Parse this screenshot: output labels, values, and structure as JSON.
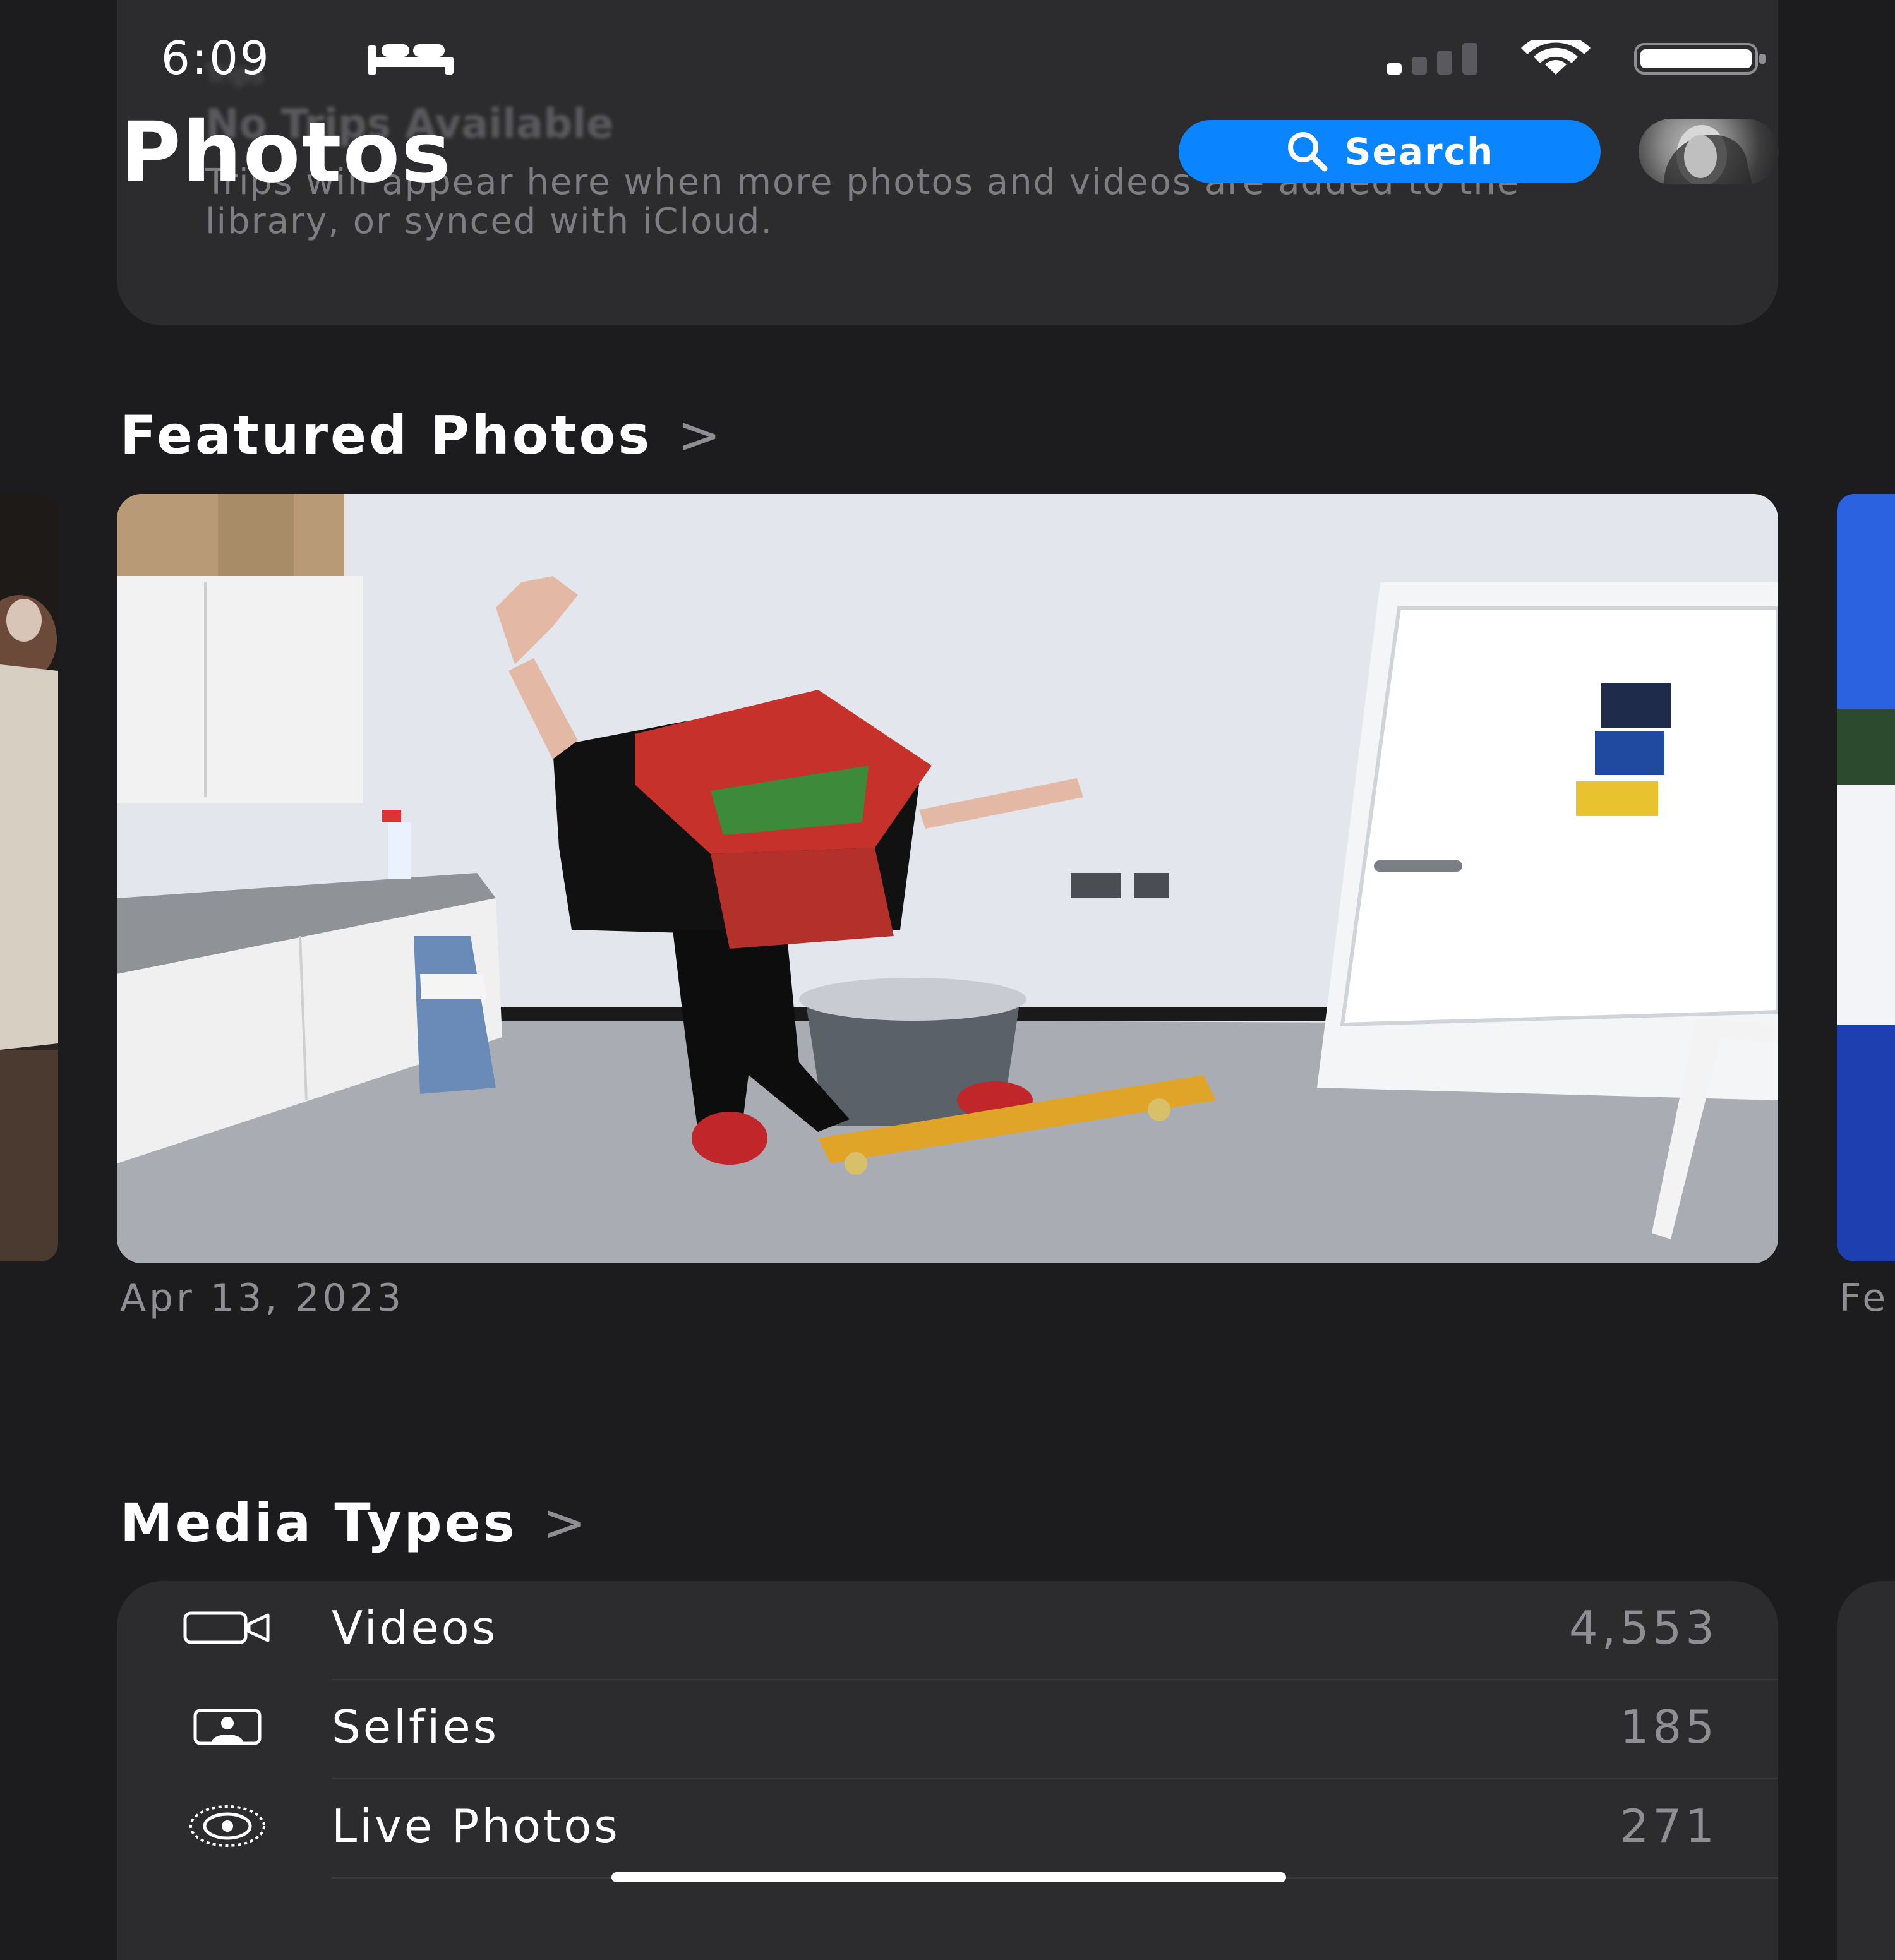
{
  "status_bar": {
    "time": "6:09",
    "sleep_icon": "bed-icon",
    "signal_icon": "cellular-signal-icon",
    "wifi_icon": "wifi-icon",
    "battery_icon": "battery-icon"
  },
  "header": {
    "title": "Photos",
    "search_label": "Search",
    "search_icon": "magnifying-glass-icon"
  },
  "trips_card": {
    "small_label": "Trips",
    "title": "No Trips Available",
    "body": "Trips will appear here when more photos and videos are added to the library, or synced with iCloud."
  },
  "featured": {
    "heading": "Featured Photos",
    "chevron": ">",
    "main_photo_date": "Apr 13, 2023",
    "next_photo_date_partial": "Fe"
  },
  "media_types": {
    "heading": "Media Types",
    "chevron": ">",
    "rows": [
      {
        "icon": "video-camera-icon",
        "label": "Videos",
        "count": "4,553"
      },
      {
        "icon": "selfie-portrait-icon",
        "label": "Selfies",
        "count": "185"
      },
      {
        "icon": "live-photo-icon",
        "label": "Live Photos",
        "count": "271"
      }
    ]
  },
  "colors": {
    "background": "#1c1c1e",
    "card": "#2c2c2e",
    "accent_blue": "#0a84ff",
    "secondary_text": "#8e8e93"
  }
}
